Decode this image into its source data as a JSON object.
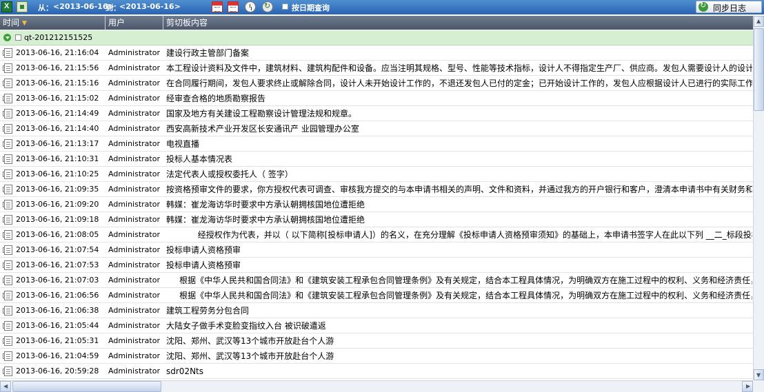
{
  "toolbar": {
    "from_label": "从：",
    "from_date": "<2013-06-16>",
    "to_label": "到：",
    "to_date": "<2013-06-16>",
    "by_date_query": "按日期查询",
    "sync_log": "同步日志"
  },
  "columns": {
    "time": "时间",
    "user": "用户",
    "content": "剪切板内容"
  },
  "group": {
    "label": "qt-201212151525"
  },
  "rows": [
    {
      "time": "2013-06-16, 21:16:04",
      "user": "Administrator",
      "content": "建设行政主管部门备案"
    },
    {
      "time": "2013-06-16, 21:15:56",
      "user": "Administrator",
      "content": "本工程设计资料及文件中，建筑材料、建筑构配件和设备。应当注明其规格、型号、性能等技术指标，设计人不得指定生产厂、供应商。发包人需要设计人的设计"
    },
    {
      "time": "2013-06-16, 21:15:16",
      "user": "Administrator",
      "content": "在合同履行期间，发包人要求终止或解除合同，设计人未开始设计工作的，不退还发包人已付的定金；已开始设计工作的，发包人应根据设计人已进行的实际工作"
    },
    {
      "time": "2013-06-16, 21:15:02",
      "user": "Administrator",
      "content": "经审查合格的地质勘察报告"
    },
    {
      "time": "2013-06-16, 21:14:49",
      "user": "Administrator",
      "content": "国家及地方有关建设工程勘察设计管理法规和规章。"
    },
    {
      "time": "2013-06-16, 21:14:40",
      "user": "Administrator",
      "content": "西安高新技术产业开发区长安通讯产 业园管理办公室"
    },
    {
      "time": "2013-06-16, 21:13:17",
      "user": "Administrator",
      "content": "电视直播"
    },
    {
      "time": "2013-06-16, 21:10:31",
      "user": "Administrator",
      "content": "投标人基本情况表"
    },
    {
      "time": "2013-06-16, 21:10:25",
      "user": "Administrator",
      "content": "法定代表人或授权委托人（ 签字）"
    },
    {
      "time": "2013-06-16, 21:09:35",
      "user": "Administrator",
      "content": "按资格预审文件的要求，你方授权代表可调查、审核我方提交的与本申请书相关的声明、文件和资料，并通过我方的开户银行和客户，澄清本申请书中有关财务和"
    },
    {
      "time": "2013-06-16, 21:09:20",
      "user": "Administrator",
      "content": "韩媒：崔龙海访华时要求中方承认朝拥核国地位遭拒绝"
    },
    {
      "time": "2013-06-16, 21:09:18",
      "user": "Administrator",
      "content": "韩媒：崔龙海访华时要求中方承认朝拥核国地位遭拒绝"
    },
    {
      "time": "2013-06-16, 21:08:05",
      "user": "Administrator",
      "content": "            经授权作为代表，并以（ 以下简称[投标申请人]）的名义，在充分理解《投标申请人资格预审须知》的基础上，本申请书签字人在此以下列 __二_标段投标申"
    },
    {
      "time": "2013-06-16, 21:07:54",
      "user": "Administrator",
      "content": "投标申请人资格预审"
    },
    {
      "time": "2013-06-16, 21:07:53",
      "user": "Administrator",
      "content": "投标申请人资格预审"
    },
    {
      "time": "2013-06-16, 21:07:03",
      "user": "Administrator",
      "content": "     根据《中华人民共和国合同法》和《建筑安装工程承包合同管理条例》及有关规定，结合本工程具体情况，为明确双方在施工过程中的权利、义务和经济责任，"
    },
    {
      "time": "2013-06-16, 21:06:56",
      "user": "Administrator",
      "content": "     根据《中华人民共和国合同法》和《建筑安装工程承包合同管理条例》及有关规定，结合本工程具体情况，为明确双方在施工过程中的权利、义务和经济责任，"
    },
    {
      "time": "2013-06-16, 21:06:38",
      "user": "Administrator",
      "content": "建筑工程劳务分包合同"
    },
    {
      "time": "2013-06-16, 21:05:44",
      "user": "Administrator",
      "content": "大陆女子做手术变脸变指纹入台 被识破遣返"
    },
    {
      "time": "2013-06-16, 21:05:31",
      "user": "Administrator",
      "content": "沈阳、郑州、武汉等13个城市开放赴台个人游"
    },
    {
      "time": "2013-06-16, 21:04:59",
      "user": "Administrator",
      "content": "沈阳、郑州、武汉等13个城市开放赴台个人游"
    },
    {
      "time": "2013-06-16, 20:59:28",
      "user": "Administrator",
      "content": "sdr02Nts"
    }
  ]
}
